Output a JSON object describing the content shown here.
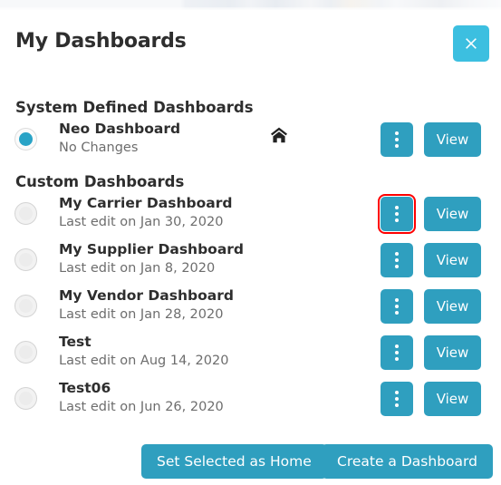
{
  "modal": {
    "title": "My Dashboards",
    "close_label": "Close",
    "close_icon": "close-icon"
  },
  "sections": {
    "system": {
      "heading": "System Defined Dashboards",
      "items": [
        {
          "name": "Neo Dashboard",
          "status": "No Changes",
          "selected": true,
          "is_home": true,
          "home_icon": "home-icon",
          "menu_icon": "kebab-menu-icon",
          "view_label": "View",
          "highlighted": false
        }
      ]
    },
    "custom": {
      "heading": "Custom Dashboards",
      "items": [
        {
          "name": "My Carrier Dashboard",
          "status": "Last edit on Jan 30, 2020",
          "selected": false,
          "is_home": false,
          "menu_icon": "kebab-menu-icon",
          "view_label": "View",
          "highlighted": true
        },
        {
          "name": "My Supplier Dashboard",
          "status": "Last edit on Jan 8, 2020",
          "selected": false,
          "is_home": false,
          "menu_icon": "kebab-menu-icon",
          "view_label": "View",
          "highlighted": false
        },
        {
          "name": "My Vendor Dashboard",
          "status": "Last edit on Jan 28, 2020",
          "selected": false,
          "is_home": false,
          "menu_icon": "kebab-menu-icon",
          "view_label": "View",
          "highlighted": false
        },
        {
          "name": "Test",
          "status": "Last edit on Aug 14, 2020",
          "selected": false,
          "is_home": false,
          "menu_icon": "kebab-menu-icon",
          "view_label": "View",
          "highlighted": false
        },
        {
          "name": "Test06",
          "status": "Last edit on Jun 26, 2020",
          "selected": false,
          "is_home": false,
          "menu_icon": "kebab-menu-icon",
          "view_label": "View",
          "highlighted": false
        }
      ]
    }
  },
  "footer": {
    "set_home_label": "Set Selected as Home",
    "create_label": "Create a Dashboard"
  },
  "colors": {
    "accent_button": "#2f9fbf",
    "close_button": "#3cbfe0",
    "radio_selected": "#29a3c6",
    "highlight_outline": "#ff0000",
    "text_primary": "#2e2e2e",
    "text_secondary": "#6d6d6d"
  }
}
